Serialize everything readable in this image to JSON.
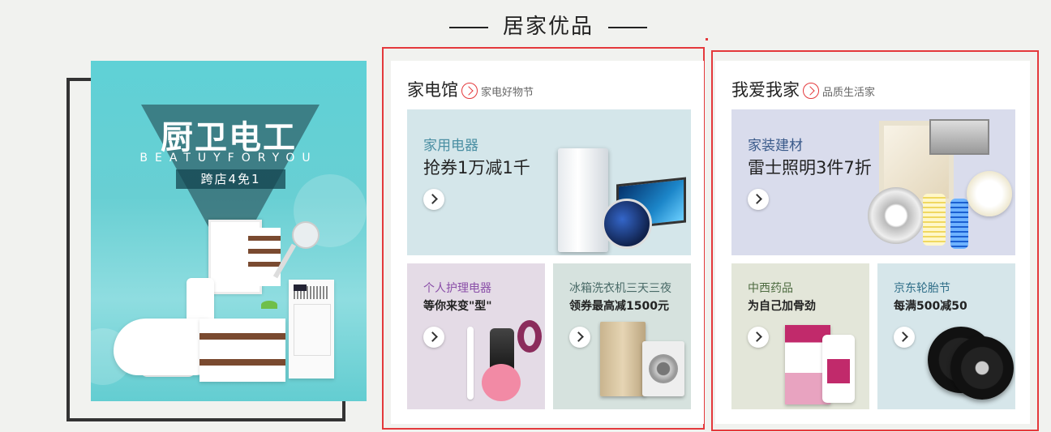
{
  "section": {
    "title": "居家优品"
  },
  "banner": {
    "title": "厨卫电工",
    "subtitle": "BEATUYFORYOU",
    "tag": "跨店4免1",
    "bg_color": "#5fd1d6"
  },
  "panels": [
    {
      "title": "家电馆",
      "subtitle": "家电好物节",
      "main": {
        "label": "家用电器",
        "text": "抢券1万减1千",
        "label_color": "#4a8fa3",
        "bg": "#d4e6ea"
      },
      "cards": [
        {
          "label": "个人护理电器",
          "text": "等你来变\"型\"",
          "label_color": "#8a4fa8",
          "bg": "#e4dbe6"
        },
        {
          "label": "冰箱洗衣机三天三夜",
          "text": "领券最高减1500元",
          "label_color": "#4a6b68",
          "bg": "#d6e2de"
        }
      ]
    },
    {
      "title": "我爱我家",
      "subtitle": "品质生活家",
      "main": {
        "label": "家装建材",
        "text": "雷士照明3件7折",
        "label_color": "#3a5a8a",
        "bg": "#d9dcec"
      },
      "cards": [
        {
          "label": "中西药品",
          "text": "为自己加骨劲",
          "label_color": "#4d6b40",
          "bg": "#e3e6d9"
        },
        {
          "label": "京东轮胎节",
          "text": "每满500减50",
          "label_color": "#2f6e88",
          "bg": "#d6e6ea"
        }
      ]
    }
  ],
  "icons": {
    "arrow": "chevron-right-icon",
    "circle_arrow": "circle-arrow-icon"
  },
  "colors": {
    "accent": "#e4393c",
    "background": "#f1f2ef"
  }
}
